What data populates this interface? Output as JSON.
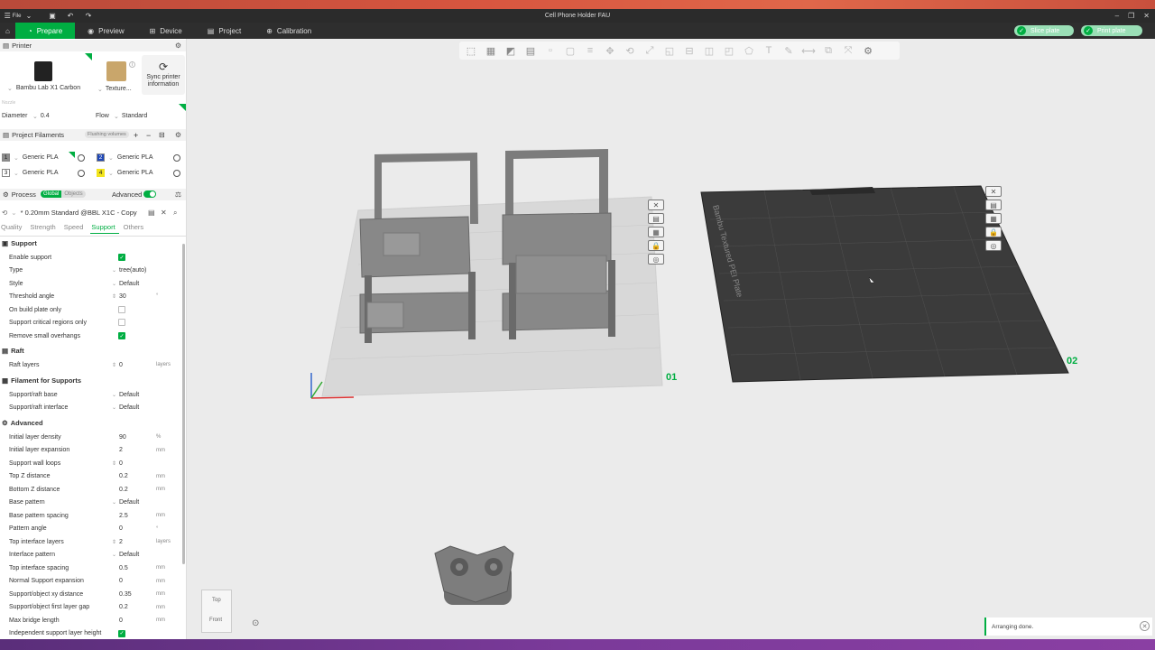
{
  "window": {
    "title": "Cell Phone Holder FAU",
    "file_menu": "File"
  },
  "nav": {
    "tabs": [
      {
        "label": "Prepare"
      },
      {
        "label": "Preview"
      },
      {
        "label": "Device"
      },
      {
        "label": "Project"
      },
      {
        "label": "Calibration"
      }
    ],
    "slice_label": "Slice plate",
    "print_label": "Print plate"
  },
  "printer": {
    "header": "Printer",
    "name": "Bambu Lab X1 Carbon",
    "plate": "Texture...",
    "sync_label": "Sync printer information",
    "nozzle_label": "Nozzle",
    "diameter_label": "Diameter",
    "diameter_value": "0.4",
    "flow_label": "Flow",
    "flow_value": "Standard"
  },
  "filaments": {
    "header": "Project Filaments",
    "flushing_label": "Flushing volumes",
    "items": [
      {
        "num": "1",
        "name": "Generic PLA",
        "color": "#8c8c8c"
      },
      {
        "num": "2",
        "name": "Generic PLA",
        "color": "#1e47b8"
      },
      {
        "num": "3",
        "name": "Generic PLA",
        "color": "#ffffff"
      },
      {
        "num": "4",
        "name": "Generic PLA",
        "color": "#f2e41c"
      }
    ]
  },
  "process": {
    "header": "Process",
    "global_label": "Global",
    "objects_label": "Objects",
    "advanced_label": "Advanced",
    "preset": "* 0.20mm Standard @BBL X1C - Copy",
    "tabs": [
      "Quality",
      "Strength",
      "Speed",
      "Support",
      "Others"
    ]
  },
  "support": {
    "group_support": "Support",
    "enable_support": "Enable support",
    "type_label": "Type",
    "type_value": "tree(auto)",
    "style_label": "Style",
    "style_value": "Default",
    "threshold_label": "Threshold angle",
    "threshold_value": "30",
    "on_build_plate": "On build plate only",
    "critical_regions": "Support critical regions only",
    "remove_small": "Remove small overhangs",
    "group_raft": "Raft",
    "raft_layers_label": "Raft layers",
    "raft_layers_value": "0",
    "raft_unit": "layers",
    "group_filament": "Filament for Supports",
    "base_label": "Support/raft base",
    "base_value": "Default",
    "interface_label": "Support/raft interface",
    "interface_value": "Default",
    "group_advanced": "Advanced",
    "adv_rows": [
      {
        "label": "Initial layer density",
        "value": "90",
        "unit": "%"
      },
      {
        "label": "Initial layer expansion",
        "value": "2",
        "unit": "mm"
      },
      {
        "label": "Support wall loops",
        "value": "0",
        "unit": ""
      },
      {
        "label": "Top Z distance",
        "value": "0.2",
        "unit": "mm"
      },
      {
        "label": "Bottom Z distance",
        "value": "0.2",
        "unit": "mm"
      },
      {
        "label": "Base pattern",
        "value": "Default",
        "unit": ""
      },
      {
        "label": "Base pattern spacing",
        "value": "2.5",
        "unit": "mm"
      },
      {
        "label": "Pattern angle",
        "value": "0",
        "unit": "°"
      },
      {
        "label": "Top interface layers",
        "value": "2",
        "unit": "layers"
      },
      {
        "label": "Interface pattern",
        "value": "Default",
        "unit": ""
      },
      {
        "label": "Top interface spacing",
        "value": "0.5",
        "unit": "mm"
      },
      {
        "label": "Normal Support expansion",
        "value": "0",
        "unit": "mm"
      },
      {
        "label": "Support/object xy distance",
        "value": "0.35",
        "unit": "mm"
      },
      {
        "label": "Support/object first layer gap",
        "value": "0.2",
        "unit": "mm"
      },
      {
        "label": "Max bridge length",
        "value": "0",
        "unit": "mm"
      },
      {
        "label": "Independent support layer height",
        "value": "",
        "unit": ""
      }
    ]
  },
  "viewport": {
    "plate1_label": "01",
    "plate2_label": "02",
    "plate_text": "Bambu Textured PEI Plate",
    "view_top": "Top",
    "view_front": "Front",
    "toast": "Arranging done."
  }
}
